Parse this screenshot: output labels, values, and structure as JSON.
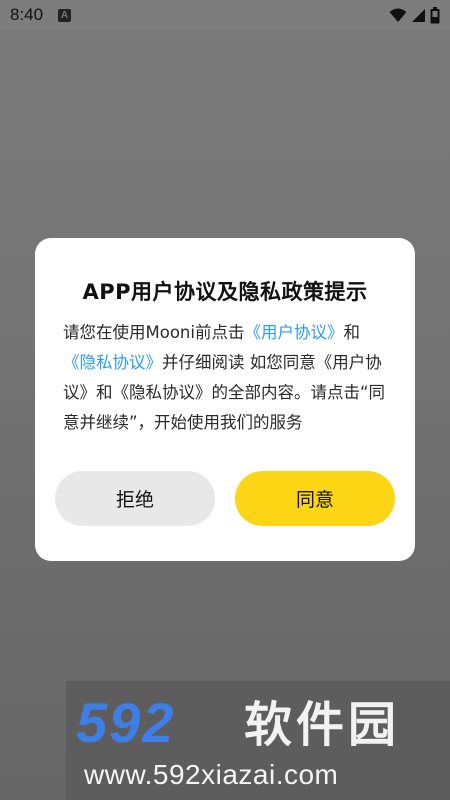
{
  "status_bar": {
    "time": "8:40",
    "notification_letter": "A"
  },
  "dialog": {
    "title": "APP用户协议及隐私政策提示",
    "body": {
      "part1": "请您在使用Mooni前点击",
      "link1": "《用户协议》",
      "part2": "和",
      "link2": "《隐私协议》",
      "part3": "并仔细阅读 如您同意《用户协议》和《隐私协议》的全部内容。请点击“同意并继续”，开始使用我们的服务"
    },
    "reject_label": "拒绝",
    "agree_label": "同意"
  },
  "watermark": {
    "logo_number": "592",
    "logo_text": "软件园",
    "url": "www.592xiazai.com"
  },
  "colors": {
    "link": "#2a9df4",
    "agree_button": "#fcd514",
    "reject_button": "#e8e8e8",
    "logo_blue": "#3d7fe6"
  },
  "icons": [
    "wifi-icon",
    "signal-icon",
    "battery-icon"
  ]
}
